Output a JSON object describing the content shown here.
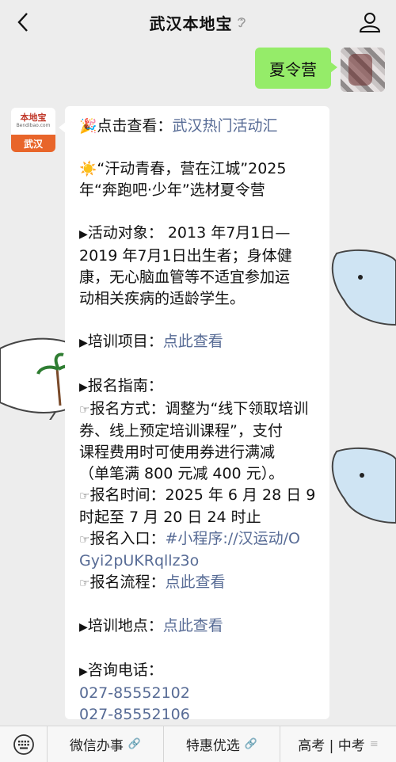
{
  "header": {
    "title": "武汉本地宝"
  },
  "outgoing": {
    "text": "夏令营"
  },
  "account_logo": {
    "name": "本地宝",
    "domain": "Bendibao.com",
    "city": "武汉"
  },
  "message": {
    "l1_prefix": "点击查看：",
    "l1_link": "武汉热门活动汇",
    "l2": "“汗动青春，营在江城”2025",
    "l3": "年“奔跑吧·少年”选材夏令营",
    "l4": "活动对象：  2013 年7月1日—",
    "l5": "2019 年7月1日出生者；身体健",
    "l6": "康，无心脑血管等不适宜参加运",
    "l7": "动相关疾病的适龄学生。",
    "l8_prefix": "培训项目：",
    "l8_link": "点此查看",
    "l9": "报名指南：",
    "l10": "报名方式：调整为“线下领取培训",
    "l11": "券、线上预定培训课程”，支付",
    "l12": "课程费用时可使用券进行满减",
    "l13": "（单笔满 800 元减 400 元）。",
    "l14": "报名时间：2025 年 6 月 28 日 9",
    "l15": "时起至 7 月 20 日 24 时止",
    "l16_prefix": "报名入口：",
    "l16_link": "#小程序://汉运动/O",
    "l17_link": "Gyi2pUKRqllz3o",
    "l18_prefix": "报名流程：",
    "l18_link": "点此查看",
    "l19_prefix": "培训地点：",
    "l19_link": "点此查看",
    "l20": "咨询电话：",
    "phone1": "027-85552102",
    "phone2": "027-85552106"
  },
  "bottom_menu": [
    {
      "label": "微信办事"
    },
    {
      "label": "特惠优选"
    },
    {
      "label": "高考 | 中考"
    }
  ],
  "colors": {
    "link": "#576b95",
    "outgoing_bubble": "#95ec69",
    "logo_orange": "#e8652a"
  },
  "icons": [
    "chevron-left-icon",
    "ear-icon",
    "person-icon",
    "keyboard-icon",
    "link-icon",
    "menu-lines-icon",
    "party-popper-icon",
    "sun-icon"
  ]
}
